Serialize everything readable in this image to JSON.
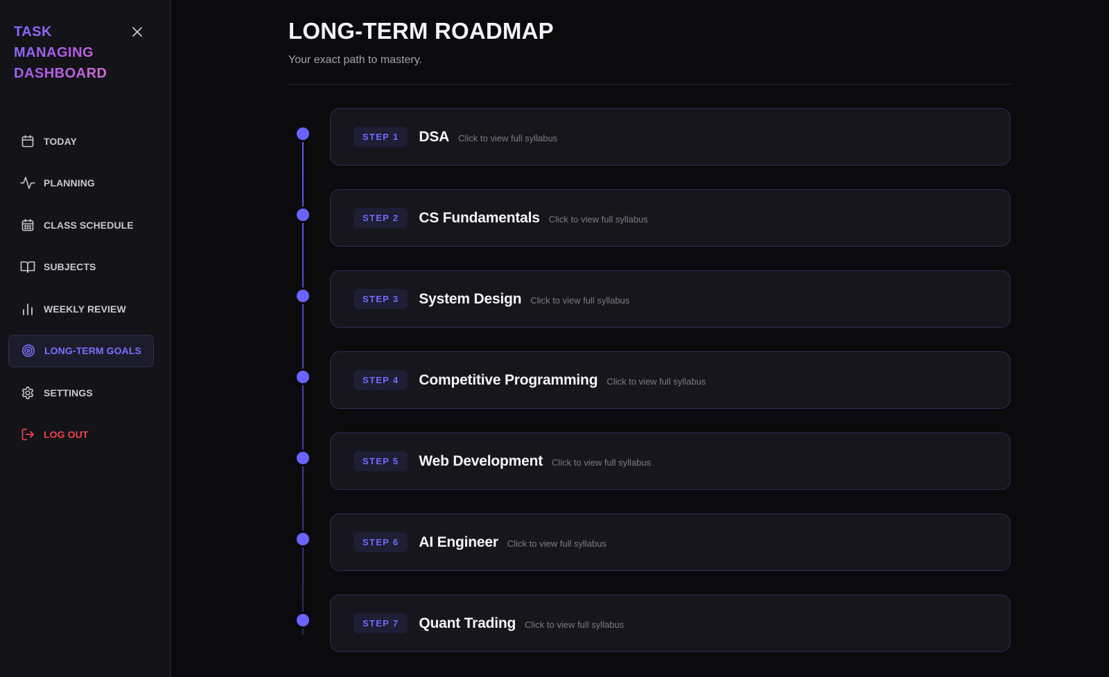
{
  "sidebar": {
    "brand_lines": [
      "TASK",
      "MANAGING",
      "DASHBOARD"
    ],
    "close_icon": "close-icon",
    "items": [
      {
        "label": "TODAY",
        "icon": "calendar-icon"
      },
      {
        "label": "PLANNING",
        "icon": "activity-icon"
      },
      {
        "label": "CLASS SCHEDULE",
        "icon": "calendar-grid-icon"
      },
      {
        "label": "SUBJECTS",
        "icon": "book-icon"
      },
      {
        "label": "WEEKLY REVIEW",
        "icon": "bar-chart-icon"
      },
      {
        "label": "LONG-TERM GOALS",
        "icon": "target-icon",
        "active": true
      },
      {
        "label": "SETTINGS",
        "icon": "gear-icon"
      }
    ],
    "logout": {
      "label": "LOG OUT",
      "icon": "logout-icon"
    }
  },
  "main": {
    "title": "LONG-TERM ROADMAP",
    "subtitle": "Your exact path to mastery.",
    "steps": [
      {
        "badge": "STEP 1",
        "title": "DSA",
        "hint": "Click to view full syllabus"
      },
      {
        "badge": "STEP 2",
        "title": "CS Fundamentals",
        "hint": "Click to view full syllabus"
      },
      {
        "badge": "STEP 3",
        "title": "System Design",
        "hint": "Click to view full syllabus"
      },
      {
        "badge": "STEP 4",
        "title": "Competitive Programming",
        "hint": "Click to view full syllabus"
      },
      {
        "badge": "STEP 5",
        "title": "Web Development",
        "hint": "Click to view full syllabus"
      },
      {
        "badge": "STEP 6",
        "title": "AI Engineer",
        "hint": "Click to view full syllabus"
      },
      {
        "badge": "STEP 7",
        "title": "Quant Trading",
        "hint": "Click to view full syllabus"
      }
    ]
  },
  "colors": {
    "accent": "#6964ff",
    "logout": "#f0434c",
    "background": "#0b0b0e",
    "card": "#16161c"
  }
}
